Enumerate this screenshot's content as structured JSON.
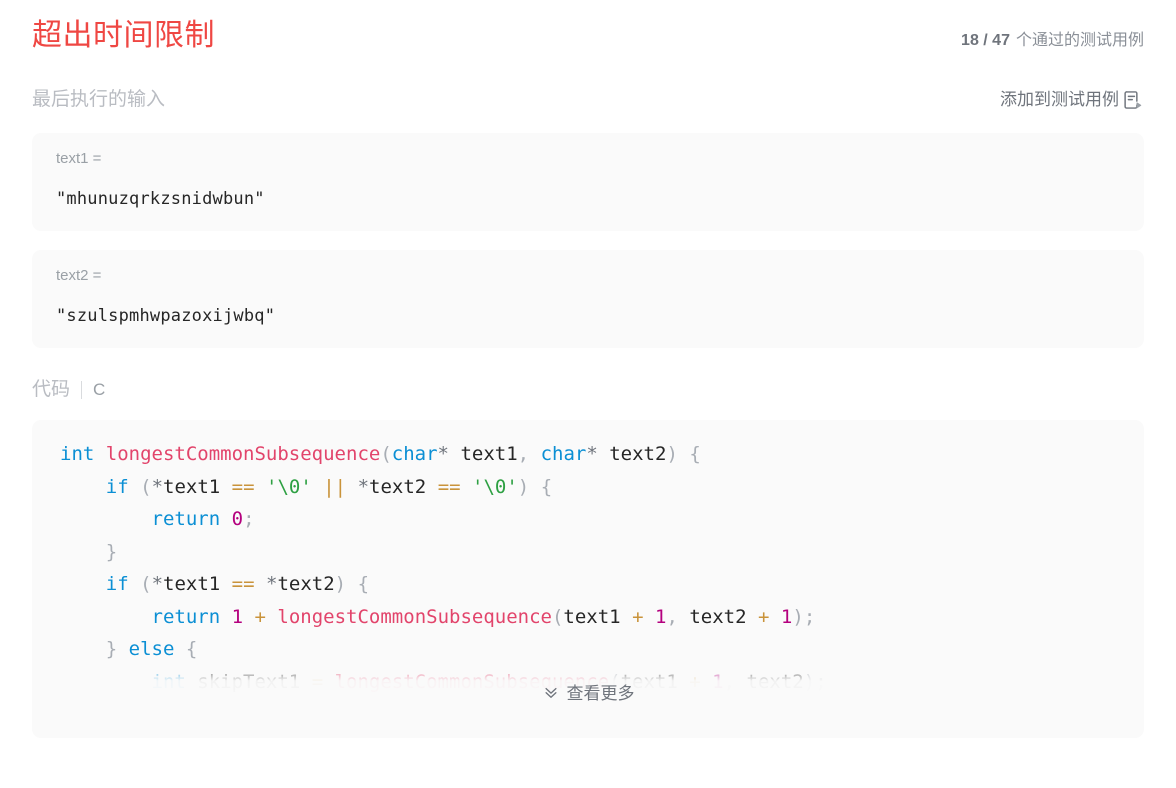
{
  "header": {
    "status_title": "超出时间限制",
    "status_color": "#ef4743",
    "testcases_passed": "18 / 47",
    "testcases_label": "个通过的测试用例"
  },
  "input_section": {
    "section_label": "最后执行的输入",
    "add_testcase_label": "添加到测试用例",
    "add_testcase_icon": "file-run-icon",
    "fields": [
      {
        "name": "text1 =",
        "value": "\"mhunuzqrkzsnidwbun\""
      },
      {
        "name": "text2 =",
        "value": "\"szulspmhwpazoxijwbq\""
      }
    ]
  },
  "code_section": {
    "label": "代码",
    "language": "C",
    "view_more_label": "查看更多",
    "view_more_icon": "double-chevron-down-icon",
    "lines": [
      "int longestCommonSubsequence(char* text1, char* text2) {",
      "    if (*text1 == '\\0' || *text2 == '\\0') {",
      "        return 0;",
      "    }",
      "    if (*text1 == *text2) {",
      "        return 1 + longestCommonSubsequence(text1 + 1, text2 + 1);",
      "    } else {",
      "        int skipText1 = longestCommonSubsequence(text1 + 1, text2);"
    ]
  }
}
